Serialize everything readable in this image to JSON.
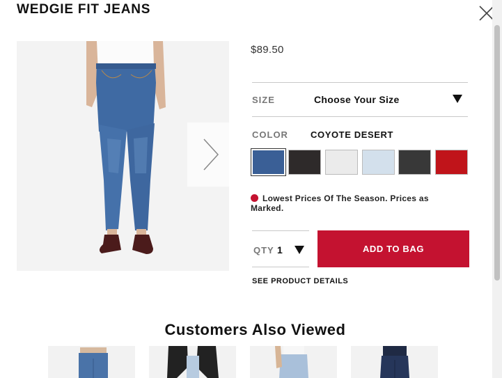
{
  "product": {
    "title": "WEDGIE FIT JEANS",
    "price": "$89.50"
  },
  "size": {
    "label": "SIZE",
    "value": "Choose Your Size"
  },
  "color": {
    "label": "COLOR",
    "value": "COYOTE DESERT",
    "swatches": [
      {
        "name": "medium-blue-denim",
        "color": "#3a5f96",
        "selected": true
      },
      {
        "name": "black-denim",
        "color": "#2e2a2a",
        "selected": false
      },
      {
        "name": "white-denim",
        "color": "#ebebeb",
        "selected": false
      },
      {
        "name": "light-blue-denim",
        "color": "#d3e0ec",
        "selected": false
      },
      {
        "name": "charcoal-denim",
        "color": "#383838",
        "selected": false
      },
      {
        "name": "red-denim",
        "color": "#c0141a",
        "selected": false
      }
    ]
  },
  "promo": {
    "text": "Lowest Prices Of The Season. Prices as Marked."
  },
  "quantity": {
    "label": "QTY",
    "value": "1"
  },
  "actions": {
    "add_to_bag": "ADD TO BAG",
    "see_details": "SEE PRODUCT DETAILS"
  },
  "recommendations": {
    "heading": "Customers Also Viewed"
  },
  "colors": {
    "accent": "#c41230",
    "denim": "#3f6aa3"
  }
}
